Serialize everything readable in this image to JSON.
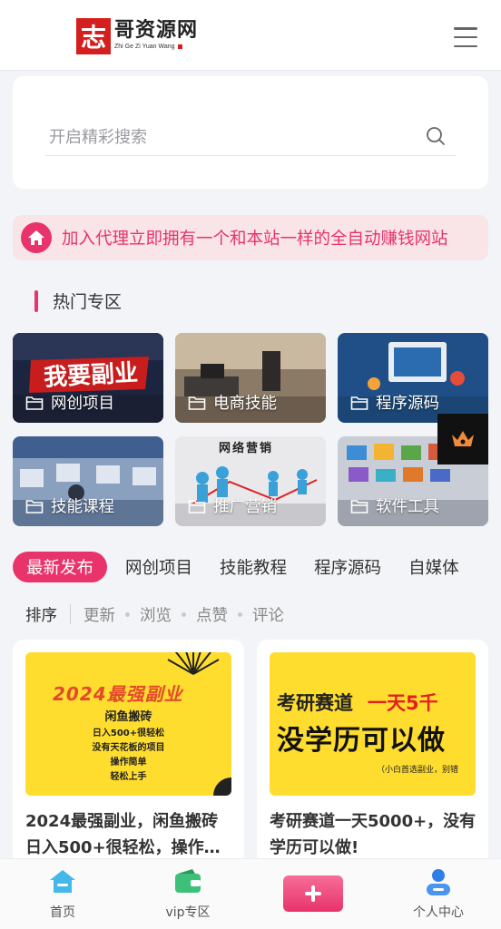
{
  "header": {
    "logo_mark": "志",
    "logo_cn": "哥资源网",
    "logo_en": "Zhi Ge Zi Yuan Wang",
    "menu_icon": "hamburger-menu-icon"
  },
  "search": {
    "placeholder": "开启精彩搜索",
    "value": "",
    "icon": "search-icon"
  },
  "agent_banner": {
    "icon": "home-icon",
    "text": "加入代理立即拥有一个和本站一样的全自动赚钱网站"
  },
  "hot_section": {
    "title": "热门专区",
    "categories": [
      {
        "label": "网创项目",
        "image_text": "我要副业",
        "icon": "folder-icon"
      },
      {
        "label": "电商技能",
        "icon": "folder-icon"
      },
      {
        "label": "程序源码",
        "icon": "folder-icon"
      },
      {
        "label": "技能课程",
        "icon": "folder-icon"
      },
      {
        "label": "推广营销",
        "image_text": "网络营销",
        "icon": "folder-icon"
      },
      {
        "label": "软件工具",
        "icon": "folder-icon"
      }
    ],
    "crown_icon": "crown-icon"
  },
  "tabs": [
    {
      "label": "最新发布",
      "active": true
    },
    {
      "label": "网创项目",
      "active": false
    },
    {
      "label": "技能教程",
      "active": false
    },
    {
      "label": "程序源码",
      "active": false
    },
    {
      "label": "自媒体",
      "active": false
    }
  ],
  "sort": {
    "label": "排序",
    "options": [
      "更新",
      "浏览",
      "点赞",
      "评论"
    ]
  },
  "posts": [
    {
      "title": "2024最强副业，闲鱼搬砖日入500+很轻松，操作…",
      "thumb_headline": "2024最强副业",
      "thumb_lines": [
        "闲鱼搬砖",
        "日入500+很轻松",
        "没有天花板的项目",
        "操作简单",
        "轻松上手"
      ]
    },
    {
      "title": "考研赛道一天5000+，没有学历可以做!",
      "thumb_headline": "考研赛道",
      "thumb_headline_red": "一天5千",
      "thumb_big": "没学历可以做",
      "thumb_note": "（小白首选副业，别错"
    }
  ],
  "bottom_nav": [
    {
      "label": "首页",
      "icon": "home-nav-icon"
    },
    {
      "label": "vip专区",
      "icon": "wallet-icon"
    },
    {
      "label": "",
      "icon": "plus-icon"
    },
    {
      "label": "个人中心",
      "icon": "user-icon"
    }
  ],
  "colors": {
    "accent": "#e8336b",
    "banner_bg": "#f9e4e8",
    "logo_red": "#d51f1f",
    "thumb_yellow": "#ffdd2e"
  }
}
